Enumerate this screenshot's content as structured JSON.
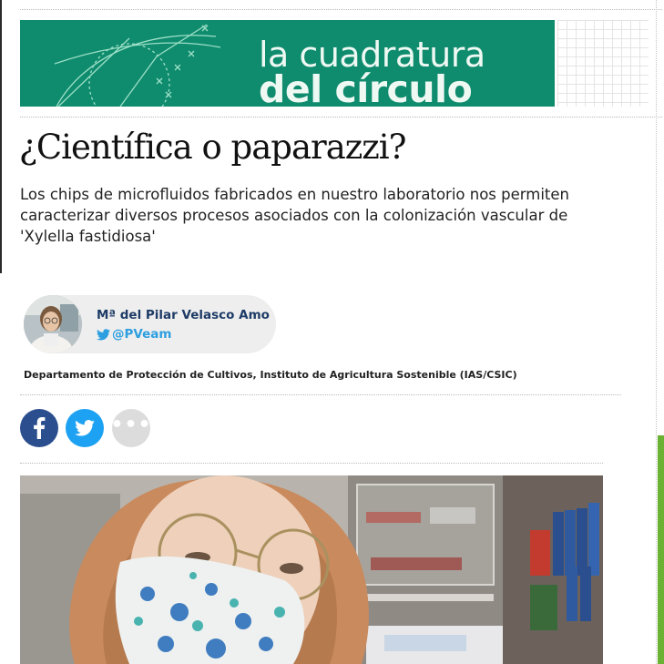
{
  "banner": {
    "line1": "la cuadratura",
    "line2": "del círculo",
    "color": "#0f8b6e"
  },
  "article": {
    "title": "¿Científica o paparazzi?",
    "subtitle": "Los chips de microfluidos fabricados en nuestro laboratorio nos permiten caracterizar diversos procesos asociados con la colonización vascular de 'Xylella fastidiosa'"
  },
  "author": {
    "name": "Mª del Pilar Velasco Amo",
    "handle": "@PVeam",
    "affiliation": "Departamento de Protección de Cultivos, Instituto de Agricultura Sostenible (IAS/CSIC)"
  },
  "share": {
    "facebook_icon": "facebook-icon",
    "twitter_icon": "twitter-icon",
    "more_icon": "more-dots-icon",
    "more_glyph": "•••",
    "facebook_color": "#2b4f8e",
    "twitter_color": "#1da1f2"
  },
  "colors": {
    "author_name": "#1d3b66",
    "handle": "#2d9ee0",
    "rail_green": "#6ab233"
  }
}
